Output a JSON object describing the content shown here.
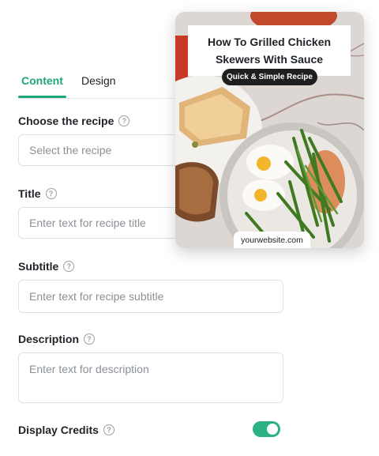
{
  "tabs": [
    {
      "label": "Content",
      "active": true
    },
    {
      "label": "Design",
      "active": false
    }
  ],
  "fields": {
    "recipe": {
      "label": "Choose the recipe",
      "placeholder": "Select the recipe"
    },
    "title": {
      "label": "Title",
      "placeholder": "Enter text for recipe title"
    },
    "subtitle": {
      "label": "Subtitle",
      "placeholder": "Enter text for recipe subtitle"
    },
    "description": {
      "label": "Description",
      "placeholder": "Enter text for description"
    },
    "credits": {
      "label": "Display Credits",
      "enabled": true
    }
  },
  "preview": {
    "title": "How To Grilled Chicken Skewers With Sauce",
    "badge": "Quick & Simple Recipe",
    "website": "yourwebsite.com"
  },
  "colors": {
    "accent": "#1fa67a",
    "toggle_on": "#2bb183",
    "badge_bg": "#1f1f1f"
  },
  "icons": {
    "help": "question-circle-icon"
  }
}
